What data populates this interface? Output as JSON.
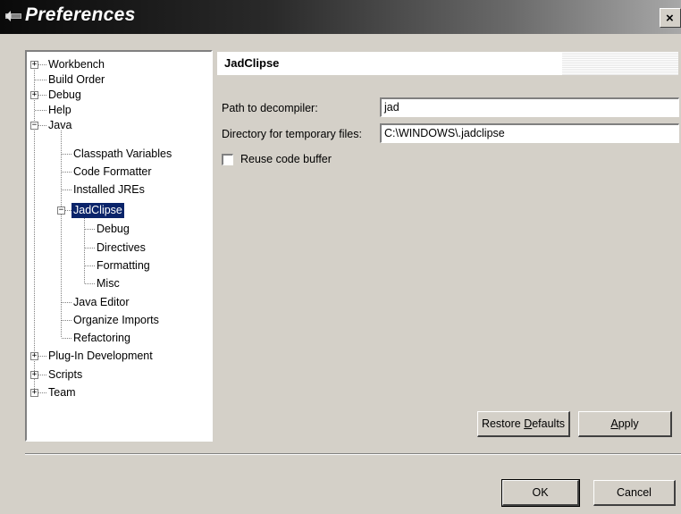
{
  "window": {
    "title": "Preferences",
    "close_glyph": "×"
  },
  "tree": {
    "items": [
      {
        "label": "Workbench",
        "expander": "+"
      },
      {
        "label": "Build Order"
      },
      {
        "label": "Debug",
        "expander": "+"
      },
      {
        "label": "Help"
      },
      {
        "label": "Java",
        "expander": "−"
      },
      {
        "label": "Classpath Variables"
      },
      {
        "label": "Code Formatter"
      },
      {
        "label": "Installed JREs"
      },
      {
        "label": "JadClipse",
        "expander": "−",
        "selected": true
      },
      {
        "label": "Debug"
      },
      {
        "label": "Directives"
      },
      {
        "label": "Formatting"
      },
      {
        "label": "Misc"
      },
      {
        "label": "Java Editor"
      },
      {
        "label": "Organize Imports"
      },
      {
        "label": "Refactoring"
      },
      {
        "label": "Plug-In Development",
        "expander": "+"
      },
      {
        "label": "Scripts",
        "expander": "+"
      },
      {
        "label": "Team",
        "expander": "+"
      }
    ]
  },
  "page": {
    "title": "JadClipse",
    "path_label": "Path to decompiler:",
    "path_value": "jad",
    "dir_label": "Directory for temporary files:",
    "dir_value": "C:\\WINDOWS\\.jadclipse",
    "reuse_label": "Reuse code buffer",
    "reuse_checked": false
  },
  "buttons": {
    "restore_pre": "Restore ",
    "restore_mn": "D",
    "restore_post": "efaults",
    "apply_mn": "A",
    "apply_post": "pply",
    "ok": "OK",
    "cancel": "Cancel"
  },
  "colors": {
    "selection": "#0a246a",
    "face": "#d4d0c8"
  }
}
